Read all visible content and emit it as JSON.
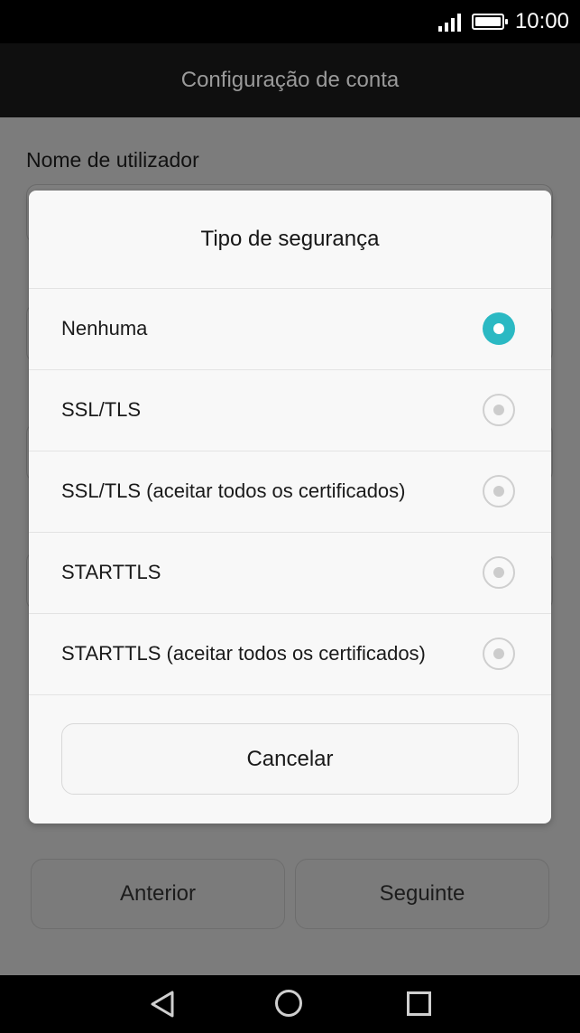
{
  "status_bar": {
    "time": "10:00"
  },
  "app_bar": {
    "title": "Configuração de conta"
  },
  "form": {
    "username_label": "Nome de utilizador"
  },
  "buttons": {
    "previous": "Anterior",
    "next": "Seguinte"
  },
  "dialog": {
    "title": "Tipo de segurança",
    "options": [
      {
        "label": "Nenhuma",
        "selected": true
      },
      {
        "label": "SSL/TLS",
        "selected": false
      },
      {
        "label": "SSL/TLS (aceitar todos os certificados)",
        "selected": false
      },
      {
        "label": "STARTTLS",
        "selected": false
      },
      {
        "label": "STARTTLS (aceitar todos os certificados)",
        "selected": false
      }
    ],
    "cancel_label": "Cancelar"
  },
  "colors": {
    "accent": "#2bb9c3",
    "dialog_bg": "#f8f8f8",
    "scrim": "#7c7c7c"
  },
  "icons": {
    "signal": "signal-icon",
    "battery": "battery-icon",
    "back": "back-icon",
    "home": "home-icon",
    "recent": "recent-apps-icon"
  }
}
